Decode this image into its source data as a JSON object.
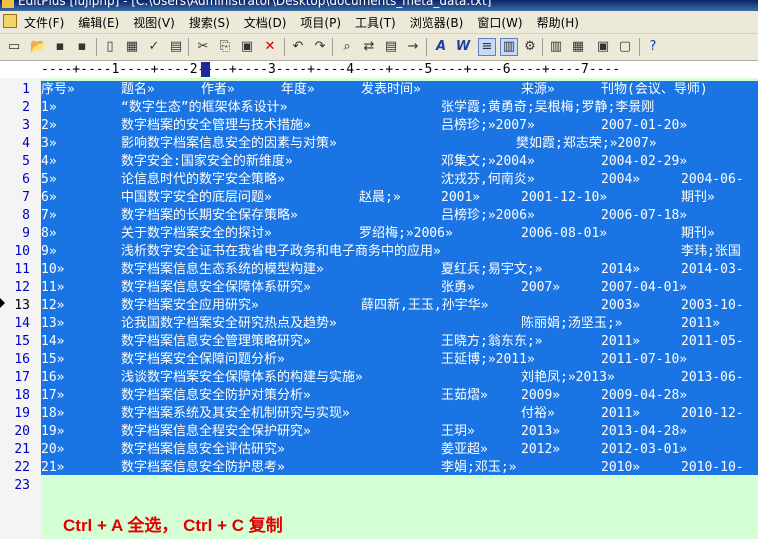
{
  "window": {
    "title": "EditPlus [lujlphp] - [C:\\Users\\Administrator\\Desktop\\documents_meta_data.txt]"
  },
  "menu": [
    "文件(F)",
    "编辑(E)",
    "视图(V)",
    "搜索(S)",
    "文档(D)",
    "项目(P)",
    "工具(T)",
    "浏览器(B)",
    "窗口(W)",
    "帮助(H)"
  ],
  "toolbar_icons": [
    "new-icon",
    "open-icon",
    "save-icon",
    "save-all-icon",
    "print-preview-icon",
    "print-icon",
    "spellcheck-icon",
    "document-icon",
    "cut-icon",
    "copy-icon",
    "paste-icon",
    "delete-icon",
    "undo-icon",
    "redo-icon",
    "find-icon",
    "replace-icon",
    "find-in-files-icon",
    "goto-icon",
    "font-icon",
    "word-wrap-icon",
    "toggle-icon",
    "column-select-icon",
    "settings-icon",
    "split-icon",
    "tile-icon",
    "close-window-icon",
    "fullscreen-icon",
    "help-icon"
  ],
  "ruler": "----+----1----+----2----+----3----+----4----+----5----+----6----+----7----",
  "line_numbers": [
    "1",
    "2",
    "3",
    "4",
    "5",
    "6",
    "7",
    "8",
    "9",
    "10",
    "11",
    "12",
    "13",
    "14",
    "15",
    "16",
    "17",
    "18",
    "19",
    "20",
    "21",
    "22",
    "23"
  ],
  "current_line": "13",
  "rows": [
    [
      "序号»",
      "题名»",
      "作者»",
      "年度»",
      "发表时间»",
      "来源»",
      "刊物(会议、导师)"
    ],
    [
      "1»",
      "“数字生态”的框架体系设计»",
      "张学霞;黄勇奇;吴根梅;罗静;李景刚"
    ],
    [
      "2»",
      "数字档案的安全管理与技术措施»",
      "吕榜珍;»2007»",
      "2007-01-20»"
    ],
    [
      "3»",
      "影响数字档案信息安全的因素与对策»",
      "樊如霞;郑志荣;»2007»"
    ],
    [
      "4»",
      "数字安全:国家安全的新维度»",
      "邓集文;»2004»",
      "2004-02-29»"
    ],
    [
      "5»",
      "论信息时代的数字安全策略»",
      "沈戎芬,何南炎»",
      "2004»",
      "2004-06-"
    ],
    [
      "6»",
      "中国数字安全的底层问题»",
      "赵晨;»",
      "2001»",
      "2001-12-10»",
      "期刊»"
    ],
    [
      "7»",
      "数字档案的长期安全保存策略»",
      "吕榜珍;»2006»",
      "2006-07-18»"
    ],
    [
      "8»",
      "关于数字档案安全的探讨»",
      "罗绍梅;»2006»",
      "2006-08-01»",
      "期刊»"
    ],
    [
      "9»",
      "浅析数字安全证书在我省电子政务和电子商务中的应用»",
      "李玮;张国"
    ],
    [
      "10»",
      "数字档案信息生态系统的模型构建»",
      "夏红兵;易宇文;»",
      "2014»",
      "2014-03-"
    ],
    [
      "11»",
      "数字档案信息安全保障体系研究»",
      "张勇»",
      "2007»",
      "2007-04-01»"
    ],
    [
      "12»",
      "数字档案安全应用研究»",
      "薛四新,王玉,孙宇华»",
      "2003»",
      "2003-10-"
    ],
    [
      "13»",
      "论我国数字档案安全研究热点及趋势»",
      "陈丽娟;汤坚玉;»",
      "2011»"
    ],
    [
      "14»",
      "数字档案信息安全管理策略研究»",
      "王晓方;翁东东;»",
      "2011»",
      "2011-05-"
    ],
    [
      "15»",
      "数字档案安全保障问题分析»",
      "王延博;»2011»",
      "2011-07-10»"
    ],
    [
      "16»",
      "浅谈数字档案安全保障体系的构建与实施»",
      "刘艳凤;»2013»",
      "2013-06-"
    ],
    [
      "17»",
      "数字档案信息安全防护对策分析»",
      "王茹熠»",
      "2009»",
      "2009-04-28»"
    ],
    [
      "18»",
      "数字档案系统及其安全机制研究与实现»",
      "付裕»",
      "2011»",
      "2010-12-"
    ],
    [
      "19»",
      "数字档案信息全程安全保护研究»",
      "王玥»",
      "2013»",
      "2013-04-28»"
    ],
    [
      "20»",
      "数字档案信息安全评估研究»",
      "姜亚超»",
      "2012»",
      "2012-03-01»"
    ],
    [
      "21»",
      "数字档案信息安全防护思考»",
      "李娟;邓玉;»",
      "2010»",
      "2010-10-"
    ]
  ],
  "annotation": "Ctrl + A 全选， Ctrl + C 复制"
}
